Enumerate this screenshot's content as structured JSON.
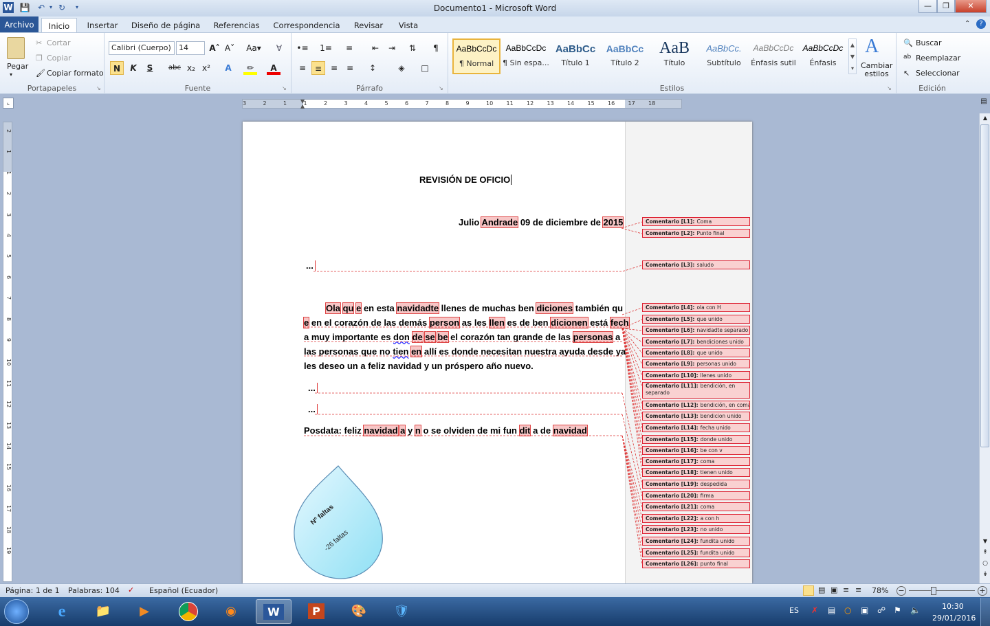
{
  "window": {
    "title": "Documento1 - Microsoft Word",
    "help": "?"
  },
  "tabs": [
    "Archivo",
    "Inicio",
    "Insertar",
    "Diseño de página",
    "Referencias",
    "Correspondencia",
    "Revisar",
    "Vista"
  ],
  "clipboard": {
    "paste": "Pegar",
    "cut": "Cortar",
    "copy": "Copiar",
    "format_painter": "Copiar formato",
    "label": "Portapapeles"
  },
  "font": {
    "name": "Calibri (Cuerpo)",
    "size": "14",
    "label": "Fuente",
    "bold": "N",
    "italic": "K",
    "underline": "S",
    "strike": "abc",
    "sub": "x₂",
    "sup": "x²"
  },
  "paragraph": {
    "label": "Párrafo"
  },
  "styles": {
    "label": "Estilos",
    "items": [
      {
        "preview": "AaBbCcDc",
        "name": "¶ Normal"
      },
      {
        "preview": "AaBbCcDc",
        "name": "¶ Sin espa..."
      },
      {
        "preview": "AaBbCc",
        "name": "Título 1"
      },
      {
        "preview": "AaBbCc",
        "name": "Título 2"
      },
      {
        "preview": "AaB",
        "name": "Título"
      },
      {
        "preview": "AaBbCc.",
        "name": "Subtítulo"
      },
      {
        "preview": "AaBbCcDc",
        "name": "Énfasis sutil"
      },
      {
        "preview": "AaBbCcDc",
        "name": "Énfasis"
      }
    ],
    "change": "Cambiar estilos"
  },
  "editing": {
    "find": "Buscar",
    "replace": "Reemplazar",
    "select": "Seleccionar",
    "label": "Edición"
  },
  "ruler_numbers": [
    "3",
    "2",
    "1",
    "1",
    "2",
    "3",
    "4",
    "5",
    "6",
    "7",
    "8",
    "9",
    "10",
    "11",
    "12",
    "13",
    "14",
    "15",
    "16",
    "17",
    "18"
  ],
  "vruler_numbers": [
    "2",
    "1",
    "1",
    "2",
    "3",
    "4",
    "5",
    "6",
    "7",
    "8",
    "9",
    "10",
    "11",
    "12",
    "13",
    "14",
    "15",
    "16",
    "17",
    "18",
    "19"
  ],
  "doc": {
    "title": "REVISIÓN DE OFICIO",
    "date_line": [
      "Julio ",
      "Andrade",
      " 09 de diciembre de ",
      "2015"
    ],
    "ellipsis": "...",
    "p1": [
      [
        [
          "Ola",
          "h"
        ],
        [
          " ",
          ""
        ],
        [
          "qu",
          "h"
        ],
        [
          " ",
          ""
        ],
        [
          "e",
          "h"
        ],
        [
          " en esta ",
          ""
        ],
        [
          "navidadte",
          "h"
        ],
        [
          " llenes de muchas ben ",
          ""
        ],
        [
          "diciones",
          "h"
        ],
        [
          " también qu",
          ""
        ]
      ],
      [
        [
          "e",
          "h"
        ],
        [
          " en el corazón de las demás ",
          ""
        ],
        [
          "person",
          "h"
        ],
        [
          " as les ",
          ""
        ],
        [
          "llen",
          "h"
        ],
        [
          " es de ben ",
          ""
        ],
        [
          "dicionen",
          "h"
        ],
        [
          " está ",
          ""
        ],
        [
          "fech",
          "h"
        ]
      ],
      [
        [
          "a muy importante es ",
          ""
        ],
        [
          "don",
          "u"
        ],
        [
          " ",
          ""
        ],
        [
          "de",
          "h"
        ],
        [
          " ",
          ""
        ],
        [
          "se",
          "h"
        ],
        [
          " ",
          ""
        ],
        [
          "be",
          "h"
        ],
        [
          " el corazón tan grande de las ",
          ""
        ],
        [
          "personas",
          "h"
        ],
        [
          " a",
          ""
        ]
      ],
      [
        [
          "las personas que no ",
          ""
        ],
        [
          "tien",
          "u"
        ],
        [
          " ",
          ""
        ],
        [
          "en",
          "h"
        ],
        [
          " allí es donde necesitan nuestra ayuda desde ya",
          ""
        ]
      ],
      [
        [
          "les deseo un a feliz navidad y un próspero año nuevo.",
          ""
        ]
      ]
    ],
    "posdata": [
      [
        "Posdata: feliz ",
        ""
      ],
      [
        "navidad",
        "h"
      ],
      [
        " ",
        ""
      ],
      [
        "a",
        "h"
      ],
      [
        " y ",
        ""
      ],
      [
        "n",
        "h"
      ],
      [
        " o se olviden de mi fun ",
        ""
      ],
      [
        "dit",
        "h"
      ],
      [
        " a de ",
        ""
      ],
      [
        "navidad",
        "h"
      ]
    ],
    "shape_title": "Nº faltas",
    "shape_value": "-26 faltas"
  },
  "comments": [
    {
      "label": "Comentario [L1]:",
      "text": "Coma"
    },
    {
      "label": "Comentario [L2]:",
      "text": "Punto final"
    },
    {
      "label": "Comentario [L3]:",
      "text": "saludo"
    },
    {
      "label": "Comentario [L4]:",
      "text": "ola con H"
    },
    {
      "label": "Comentario [L5]:",
      "text": "que unido"
    },
    {
      "label": "Comentario [L6]:",
      "text": "navidadte separado"
    },
    {
      "label": "Comentario [L7]:",
      "text": "bendiciones unido"
    },
    {
      "label": "Comentario [L8]:",
      "text": "que unido"
    },
    {
      "label": "Comentario [L9]:",
      "text": "personas unido"
    },
    {
      "label": "Comentario [L10]:",
      "text": "llenes unido"
    },
    {
      "label": "Comentario [L11]:",
      "text": "bendición, en separado"
    },
    {
      "label": "Comentario [L12]:",
      "text": "bendición, en coma"
    },
    {
      "label": "Comentario [L13]:",
      "text": "bendicion unido"
    },
    {
      "label": "Comentario [L14]:",
      "text": "fecha unido"
    },
    {
      "label": "Comentario [L15]:",
      "text": "donde unido"
    },
    {
      "label": "Comentario [L16]:",
      "text": "be con v"
    },
    {
      "label": "Comentario [L17]:",
      "text": "coma"
    },
    {
      "label": "Comentario [L18]:",
      "text": "tienen unido"
    },
    {
      "label": "Comentario [L19]:",
      "text": "despedida"
    },
    {
      "label": "Comentario [L20]:",
      "text": "firma"
    },
    {
      "label": "Comentario [L21]:",
      "text": "coma"
    },
    {
      "label": "Comentario [L22]:",
      "text": "a con h"
    },
    {
      "label": "Comentario [L23]:",
      "text": "no unido"
    },
    {
      "label": "Comentario [L24]:",
      "text": "fundita unido"
    },
    {
      "label": "Comentario [L25]:",
      "text": "fundita unido"
    },
    {
      "label": "Comentario [L26]:",
      "text": "punto final"
    }
  ],
  "status": {
    "page": "Página: 1 de 1",
    "words": "Palabras: 104",
    "language": "Español (Ecuador)",
    "zoom": "78%"
  },
  "tray": {
    "lang": "ES",
    "time": "10:30",
    "date": "29/01/2016"
  },
  "colors": {
    "accent": "#2b5797",
    "comment_border": "#dd2233",
    "comment_fill": "#f9d1d1"
  }
}
